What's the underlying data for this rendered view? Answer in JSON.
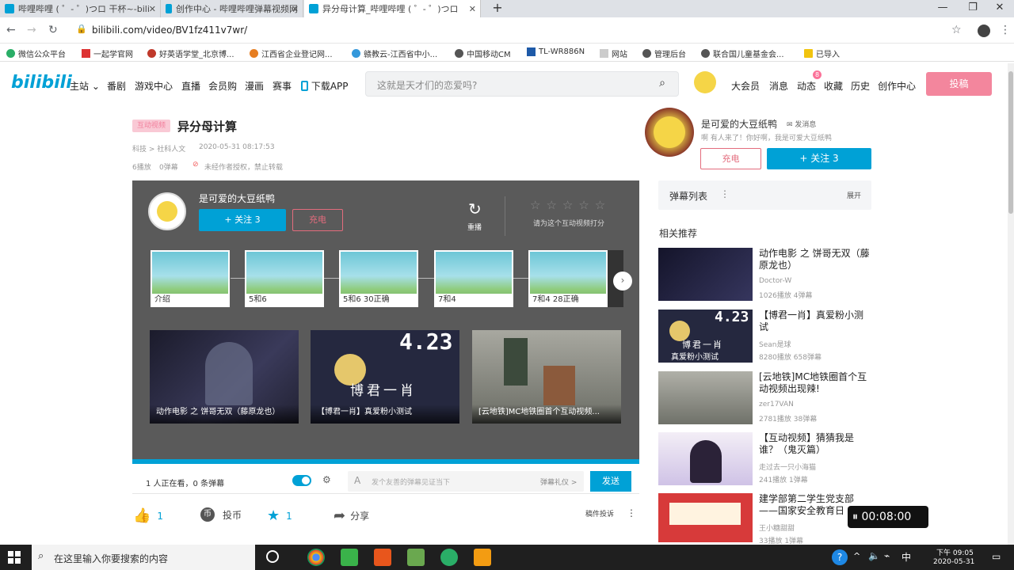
{
  "browser": {
    "tabs": [
      {
        "title": "哔哩哔哩 ( ゜- ゜)つロ 干杯~-bili"
      },
      {
        "title": "创作中心 - 哔哩哔哩弹幕视频网"
      },
      {
        "title": "异分母计算_哔哩哔哩 ( ゜- ゜)つロ"
      }
    ],
    "url": "bilibili.com/video/BV1fz411v7wr/",
    "bookmarks": [
      "微信公众平台",
      "一起学官网",
      "好英语学堂_北京博...",
      "江西省企业登记网...",
      "赣教云-江西省中小...",
      "中国移动CM",
      "TL-WR886N",
      "网站",
      "管理后台",
      "联合国儿童基金会...",
      "已导入"
    ]
  },
  "site": {
    "logo": "bilibili",
    "nav": [
      "主站",
      "番剧",
      "游戏中心",
      "直播",
      "会员购",
      "漫画",
      "赛事"
    ],
    "download": "下载APP",
    "search_placeholder": "这就是天才们的恋爱吗?",
    "user_links": [
      "大会员",
      "消息",
      "动态",
      "收藏",
      "历史",
      "创作中心"
    ],
    "dynamic_badge": "8",
    "upload_label": "投稿"
  },
  "video": {
    "tag": "互动视频",
    "title": "异分母计算",
    "category": "科技 > 社科人文",
    "date": "2020-05-31 08:17:53",
    "plays": "6播放",
    "danmaku": "0弹幕",
    "notice": "未经作者授权，禁止转载"
  },
  "player": {
    "uploader": "是可爱的大豆纸鸭",
    "follow": "+ 关注 3",
    "charge": "充电",
    "replay": "重播",
    "rate_hint": "请为这个互动视频打分",
    "nodes": [
      "介绍",
      "5和6",
      "5和6 30正确",
      "7和4",
      "7和4 28正确"
    ],
    "recommend": [
      "动作电影 之 饼哥无双（藤原龙也）",
      "【博君一肖】真爱粉小测试",
      "[云地铁]MC地铁圈首个互动视频..."
    ],
    "rec_overlay_number": "4.23",
    "rec_overlay_text": "博君一肖",
    "rec_overlay_text2": "真爱粉小测试"
  },
  "player_bar": {
    "watching": "1 人正在看，0 条弹幕",
    "danmaku_placeholder": "发个友善的弹幕见证当下",
    "etiquette": "弹幕礼仪 >",
    "send": "发送"
  },
  "actions": {
    "like": "1",
    "coin": "投币",
    "fav": "1",
    "share": "分享",
    "report": "稿件投诉"
  },
  "sidebar": {
    "uploader_name": "是可爱的大豆纸鸭",
    "message": "发消息",
    "bio": "啊  有人来了！你好啊，我是可爱大豆纸鸭",
    "charge": "充电",
    "follow": "+ 关注 3",
    "danmaku_list": "弹幕列表",
    "expand": "展开",
    "related_title": "相关推荐",
    "related": [
      {
        "title": "动作电影 之 饼哥无双（藤原龙也）",
        "up": "Doctor-W",
        "stats": "1026播放   4弹幕"
      },
      {
        "title": "【博君一肖】真爱粉小测试",
        "up": "Sean是球",
        "stats": "8280播放   658弹幕"
      },
      {
        "title": "[云地铁]MC地铁圈首个互动视频出现辣!",
        "up": "zer17VAN",
        "stats": "2781播放   38弹幕"
      },
      {
        "title": "【互动视频】猜猜我是谁？（鬼灭篇）",
        "up": "走过去一只小海猫",
        "stats": "241播放   1弹幕"
      },
      {
        "title": "建学部第二学生党支部——国家安全教育日",
        "up": "王小糖甜甜",
        "stats": "33播放   1弹幕"
      }
    ]
  },
  "timer": "00:08:00",
  "taskbar": {
    "search_placeholder": "在这里输入你要搜索的内容",
    "time": "下午 09:05",
    "date": "2020-05-31"
  }
}
